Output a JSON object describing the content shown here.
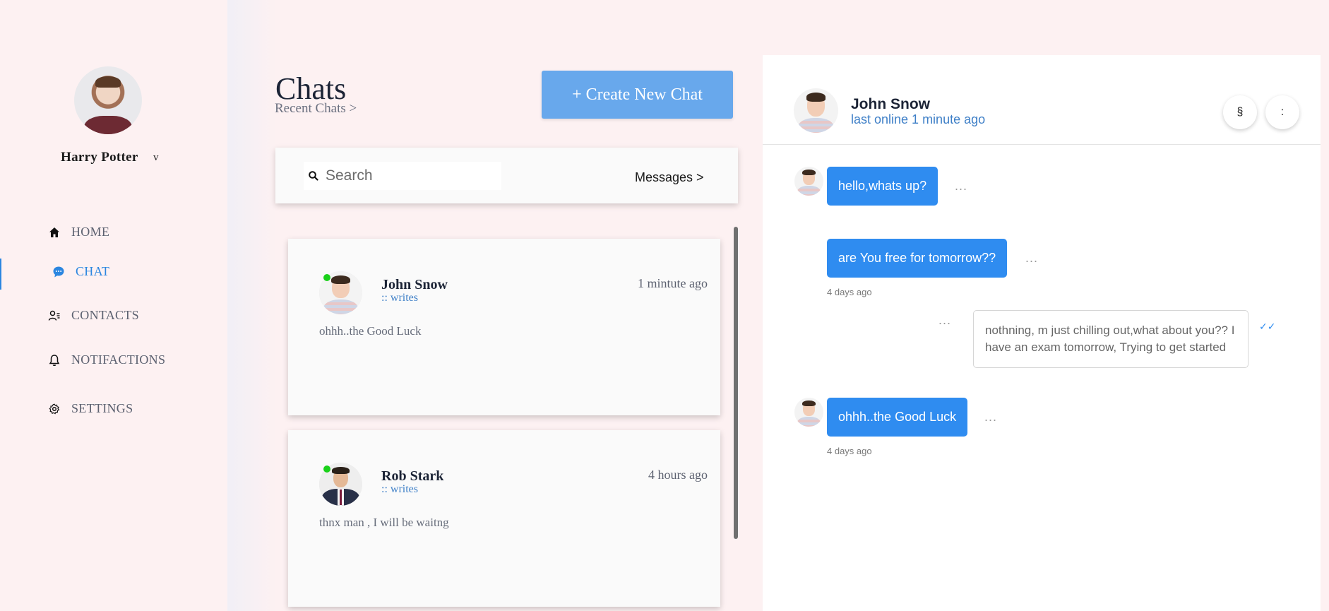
{
  "user": {
    "name": "Harry Potter",
    "menu_chevron": "v"
  },
  "nav": [
    {
      "label": "HOME",
      "icon": "home-icon"
    },
    {
      "label": "CHAT",
      "icon": "chat-icon",
      "active": true
    },
    {
      "label": "CONTACTS",
      "icon": "contacts-icon"
    },
    {
      "label": "NOTIFACTIONS",
      "icon": "bell-icon"
    },
    {
      "label": "SETTINGS",
      "icon": "gear-icon"
    }
  ],
  "chats": {
    "title": "Chats",
    "recent_link": "Recent Chats >",
    "create_button": "+ Create New Chat",
    "search_placeholder": "Search",
    "messages_link": "Messages >",
    "list": [
      {
        "name": "John Snow",
        "writes": ":: writes",
        "time": "1 mintute ago",
        "preview": "ohhh..the Good Luck",
        "online": true
      },
      {
        "name": "Rob Stark",
        "writes": ":: writes",
        "time": "4 hours ago",
        "preview": "thnx man , I will be waitng",
        "online": true
      }
    ]
  },
  "conversation": {
    "contact_name": "John Snow",
    "status": "last online 1 minute ago",
    "button_section": "§",
    "button_more": ":",
    "messages": [
      {
        "text": "hello,whats up?",
        "dots": "...",
        "direction": "in"
      },
      {
        "text": "are You free for tomorrow??",
        "dots": "...",
        "time": "4 days ago",
        "direction": "in"
      },
      {
        "text": "nothning, m just chilling out,what about you?? I have an exam tomorrow, Trying to get started",
        "dots": "...",
        "direction": "out",
        "read_icon": "double-check-icon"
      },
      {
        "text": "ohhh..the Good Luck",
        "dots": "...",
        "time": "4 days ago",
        "direction": "in"
      }
    ]
  },
  "colors": {
    "accent": "#2f8cf0",
    "button": "#68a8ec",
    "background": "#fdf1f2",
    "online": "#1ad11a"
  }
}
